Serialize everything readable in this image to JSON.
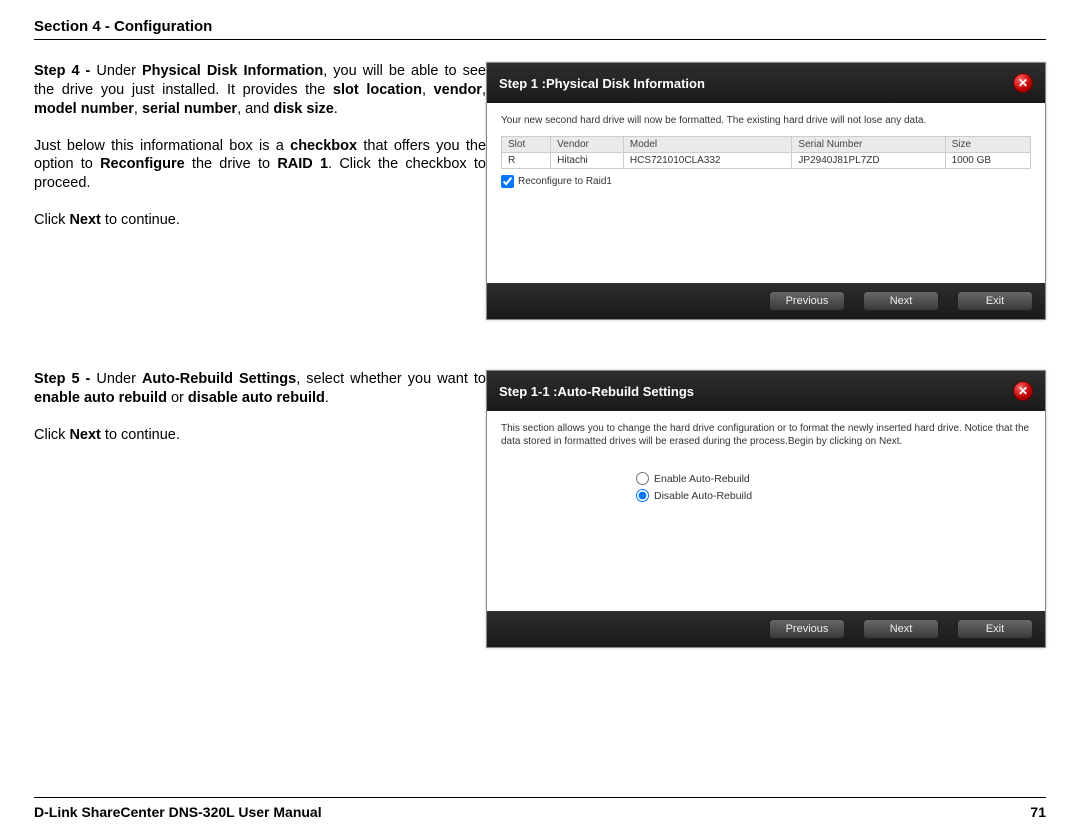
{
  "header": {
    "section": "Section 4 - Configuration"
  },
  "footer": {
    "manual": "D-Link ShareCenter DNS-320L User Manual",
    "page": "71"
  },
  "step4": {
    "label": "Step 4 - ",
    "under": "Under ",
    "title": "Physical Disk Information",
    "p1a": ", you will be able to see the drive you just installed. It provides the ",
    "slot": "slot location",
    "vendor": "vendor",
    "model": "model number",
    "serial": "serial number",
    "and": ", and ",
    "size": "disk size",
    "p2a": "Just below this informational box is a ",
    "checkbox": "checkbox",
    "p2b": " that offers you the option to ",
    "reconf": "Reconfigure",
    "p2c": " the drive to ",
    "raid": "RAID 1",
    "p2d": ". Click the checkbox to proceed.",
    "p3a": "Click ",
    "next": "Next",
    "p3b": " to continue."
  },
  "step5": {
    "label": "Step 5 - ",
    "under": "Under ",
    "title": "Auto-Rebuild Settings",
    "p1a": ", select whether you want to ",
    "enable": "enable auto rebuild",
    "or": " or ",
    "disable": "disable auto rebuild",
    "p3a": "Click ",
    "next": "Next",
    "p3b": " to continue."
  },
  "dlg1": {
    "title": "Step 1 :Physical Disk Information",
    "desc": "Your new second hard drive will now be formatted. The existing hard drive will not lose any data.",
    "headers": {
      "slot": "Slot",
      "vendor": "Vendor",
      "model": "Model",
      "serial": "Serial Number",
      "size": "Size"
    },
    "row": {
      "slot": "R",
      "vendor": "Hitachi",
      "model": "HCS721010CLA332",
      "serial": "JP2940J81PL7ZD",
      "size": "1000 GB"
    },
    "checkbox": "Reconfigure to Raid1",
    "btn": {
      "prev": "Previous",
      "next": "Next",
      "exit": "Exit"
    }
  },
  "dlg2": {
    "title": "Step 1-1 :Auto-Rebuild Settings",
    "desc": "This section allows you to change the hard drive configuration or to format the newly inserted hard drive. Notice that the data stored in formatted drives will be erased during the process.Begin by clicking on Next.",
    "opt1": "Enable Auto-Rebuild",
    "opt2": "Disable Auto-Rebuild",
    "btn": {
      "prev": "Previous",
      "next": "Next",
      "exit": "Exit"
    }
  }
}
